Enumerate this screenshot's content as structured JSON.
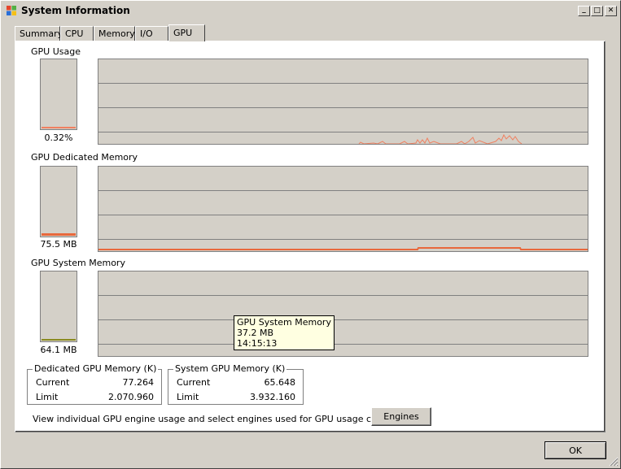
{
  "window": {
    "title": "System Information"
  },
  "titlebar_buttons": {
    "minimize": "_",
    "maximize": "□",
    "close": "✕"
  },
  "tabs": [
    {
      "label": "Summary"
    },
    {
      "label": "CPU"
    },
    {
      "label": "Memory"
    },
    {
      "label": "I/O"
    },
    {
      "label": "GPU",
      "active": true
    }
  ],
  "sections": {
    "gpu_usage": {
      "label": "GPU Usage",
      "value": "0.32%",
      "fill_fraction": 0.003
    },
    "dedicated_memory": {
      "label": "GPU Dedicated Memory",
      "value": "75.5 MB",
      "fill_fraction": 0.03
    },
    "system_memory": {
      "label": "GPU System Memory",
      "value": "64.1 MB",
      "fill_fraction": 0.02
    }
  },
  "tooltip": {
    "line1": "GPU System Memory",
    "line2": "37.2 MB",
    "line3": "14:15:13"
  },
  "dedicated_group": {
    "title": "Dedicated GPU Memory (K)",
    "current_label": "Current",
    "current_value": "77.264",
    "limit_label": "Limit",
    "limit_value": "2.070.960"
  },
  "system_group": {
    "title": "System GPU Memory (K)",
    "current_label": "Current",
    "current_value": "65.648",
    "limit_label": "Limit",
    "limit_value": "3.932.160"
  },
  "engines_prompt": "View individual GPU engine usage and select engines used for GPU usage calculations:",
  "engines_button": "Engines",
  "ok_button": "OK",
  "colors": {
    "graph_line": "#f08060",
    "memory_line": "#e8683c",
    "sys_fill": "#8a8a20",
    "tooltip_bg": "#ffffe1"
  }
}
